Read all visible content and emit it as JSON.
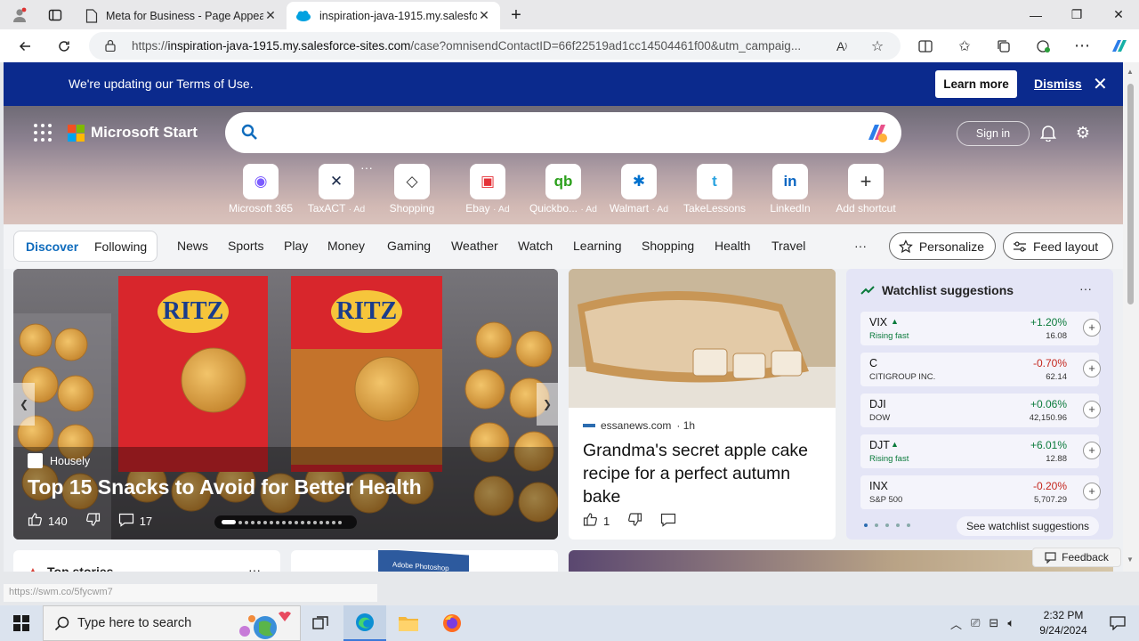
{
  "browser": {
    "tabs": [
      {
        "title": "Meta for Business - Page Appeal",
        "active": false
      },
      {
        "title": "inspiration-java-1915.my.salesfor",
        "active": true
      }
    ],
    "url_scheme": "https://",
    "url_host": "inspiration-java-1915.my.salesforce-sites.com",
    "url_rest": "/case?omnisendContactID=66f22519ad1cc14504461f00&utm_campaig..."
  },
  "banner": {
    "message": "We're updating our Terms of Use.",
    "learn_more": "Learn more",
    "dismiss": "Dismiss"
  },
  "header": {
    "brand": "Microsoft Start",
    "search_placeholder": "",
    "sign_in": "Sign in"
  },
  "shortcuts": [
    {
      "label": "Microsoft 365",
      "ad": "",
      "glyph": "◉",
      "color": "#7b5cff"
    },
    {
      "label": "TaxACT",
      "ad": "· Ad",
      "glyph": "✕",
      "color": "#1c2b4a"
    },
    {
      "label": "Shopping",
      "ad": "",
      "glyph": "◇",
      "color": "#333333"
    },
    {
      "label": "Ebay",
      "ad": "· Ad",
      "glyph": "▣",
      "color": "#e53238"
    },
    {
      "label": "Quickbo...",
      "ad": "· Ad",
      "glyph": "qb",
      "color": "#2ca01c"
    },
    {
      "label": "Walmart",
      "ad": "· Ad",
      "glyph": "✱",
      "color": "#0071ce"
    },
    {
      "label": "TakeLessons",
      "ad": "",
      "glyph": "t",
      "color": "#2aa3e0"
    },
    {
      "label": "LinkedIn",
      "ad": "",
      "glyph": "in",
      "color": "#0a66c2"
    },
    {
      "label": "Add shortcut",
      "ad": "",
      "glyph": "+",
      "color": "#333333"
    }
  ],
  "nav": {
    "discover": "Discover",
    "following": "Following",
    "items": [
      "News",
      "Sports",
      "Play",
      "Money",
      "Gaming",
      "Weather",
      "Watch",
      "Learning",
      "Shopping",
      "Health",
      "Travel"
    ],
    "more": "···",
    "personalize": "Personalize",
    "feed_layout": "Feed layout"
  },
  "carousel": {
    "source": "Housely",
    "title": "Top 15 Snacks to Avoid for Better Health",
    "likes": "140",
    "comments": "17",
    "dot_count": 18,
    "active_dot": 0
  },
  "news_card": {
    "source": "essanews.com",
    "age": "· 1h",
    "title": "Grandma's secret apple cake recipe for a perfect autumn bake",
    "likes": "1"
  },
  "watchlist": {
    "title": "Watchlist suggestions",
    "items": [
      {
        "symbol": "VIX",
        "name": "Rising fast",
        "change": "+1.20%",
        "price": "16.08",
        "dir": "up",
        "fast": true
      },
      {
        "symbol": "C",
        "name": "CITIGROUP INC.",
        "change": "-0.70%",
        "price": "62.14",
        "dir": "down",
        "fast": false
      },
      {
        "symbol": "DJI",
        "name": "DOW",
        "change": "+0.06%",
        "price": "42,150.96",
        "dir": "up",
        "fast": false
      },
      {
        "symbol": "DJT",
        "name": "Rising fast",
        "change": "+6.01%",
        "price": "12.88",
        "dir": "up",
        "fast": true
      },
      {
        "symbol": "INX",
        "name": "S&P 500",
        "change": "-0.20%",
        "price": "5,707.29",
        "dir": "down",
        "fast": false
      }
    ],
    "see_all": "See watchlist suggestions"
  },
  "partial": {
    "top_stories": "Top stories",
    "adobe": "Adobe Photoshop"
  },
  "feedback": "Feedback",
  "status_url": "https://swm.co/5fycwm7",
  "taskbar": {
    "search_placeholder": "Type here to search",
    "time": "2:32 PM",
    "date": "9/24/2024"
  },
  "colors": {
    "banner": "#0b2a8d",
    "discover_blue": "#0f6cbd",
    "up": "#0a7a3b",
    "down": "#c4261d"
  }
}
